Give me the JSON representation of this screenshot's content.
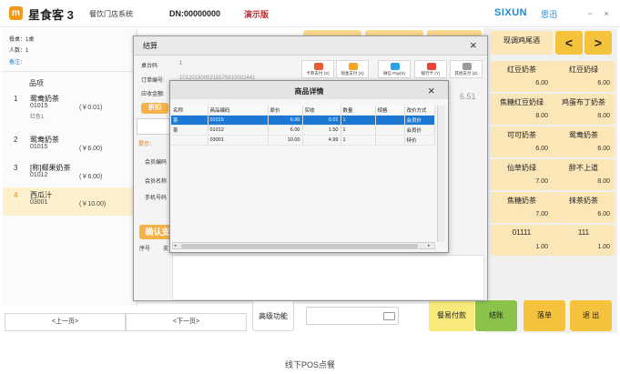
{
  "header": {
    "logo_text": "m",
    "app_name": "星食客 3",
    "subtitle": "餐饮门店系统",
    "device_number": "DN:00000000",
    "demo_badge": "演示版",
    "brand": "SIXUN",
    "brand_cn": "思迅",
    "minimize": "−",
    "close": "×"
  },
  "order_info": {
    "table": "餐桌：1桌",
    "guests": "人数：1",
    "note": "备注："
  },
  "order_list": {
    "header": "品项",
    "items": [
      {
        "index": "1",
        "name": "鸳鸯奶茶",
        "code": "01015",
        "price": "(￥0.01)",
        "extra": "红色1"
      },
      {
        "index": "2",
        "name": "鸳鸯奶茶",
        "code": "01015",
        "price": "(￥6.00)",
        "extra": ""
      },
      {
        "index": "3",
        "name": "[称]椰果奶茶",
        "code": "01012",
        "price": "(￥6.00)",
        "extra": ""
      },
      {
        "index": "4",
        "name": "西瓜汁",
        "code": "03001",
        "price": "(￥10.00)",
        "extra": ""
      }
    ]
  },
  "pager": {
    "prev": "<上一页>",
    "next": "<下一页>"
  },
  "settlement_dialog": {
    "title": "结算",
    "close": "×",
    "table_no_label": "桌台码",
    "table_no_value": "1",
    "order_no_label": "订单编号:",
    "order_no_value": "1012019000215575810002441",
    "amount_label": "应收金额:",
    "amount_value": "6.51",
    "discount_button": "折扣",
    "payments": [
      {
        "label": "卡券支付 (X)",
        "color": "#e85c3a"
      },
      {
        "label": "现金支付 (X)",
        "color": "#f2a623"
      },
      {
        "label": "微信 Pay(S)",
        "color": "#2aa3e8"
      },
      {
        "label": "银行卡 (Y)",
        "color": "#e8453a"
      },
      {
        "label": "其他支付 (Z)",
        "color": "#9a9a9a"
      }
    ],
    "tip_text": "提示：",
    "member_code_label": "会员编码",
    "member_name_label": "会员名称",
    "phone_label": "手机号码",
    "confirm_button": "确认支",
    "footer_col1": "序号",
    "footer_col2": "支"
  },
  "detail_dialog": {
    "title": "商品详情",
    "close": "×",
    "columns": [
      "名称",
      "商品编码",
      "原价",
      "实收",
      "数量",
      "规格",
      "改价方式"
    ],
    "rows": [
      [
        "茶",
        "01015",
        "6.00",
        "0.01",
        "1",
        "",
        "会员价"
      ],
      [
        "茶",
        "01012",
        "6.00",
        "1.50",
        "1",
        "",
        "会员价"
      ],
      [
        "",
        "03001",
        "10.00",
        "4.99",
        "1",
        "",
        "特价"
      ]
    ]
  },
  "dishes": {
    "top_item": "现调鸡尾酒",
    "prev_page": "<",
    "next_page": ">",
    "items": [
      {
        "name": "红豆奶茶",
        "price": "6.00"
      },
      {
        "name": "红豆奶绿",
        "price": "6.00"
      },
      {
        "name": "焦糖红豆奶绿",
        "price": "8.00"
      },
      {
        "name": "鸡蛋布丁奶茶",
        "price": "8.00"
      },
      {
        "name": "可可奶茶",
        "price": "6.00"
      },
      {
        "name": "鸳鸯奶茶",
        "price": "6.00"
      },
      {
        "name": "仙草奶绿",
        "price": "7.00"
      },
      {
        "name": "醉不上道",
        "price": "8.00"
      },
      {
        "name": "焦糖奶茶",
        "price": "7.00"
      },
      {
        "name": "抹茶奶茶",
        "price": "6.00"
      },
      {
        "name": "01111",
        "price": "1.00"
      },
      {
        "name": "111",
        "price": "1.00"
      }
    ]
  },
  "bottom_actions": {
    "advanced": "高级功能",
    "easy_pay": "餐易付款",
    "checkout": "结账",
    "list": "落单",
    "exit": "退 出"
  },
  "colors": {
    "accent_yellow": "#f5c33b",
    "dish_bg": "#fbe6b8",
    "checkout_green": "#8bc34a",
    "selection_blue": "#1c79d3",
    "brand_blue": "#1e88d2"
  },
  "caption": "线下POS点餐"
}
